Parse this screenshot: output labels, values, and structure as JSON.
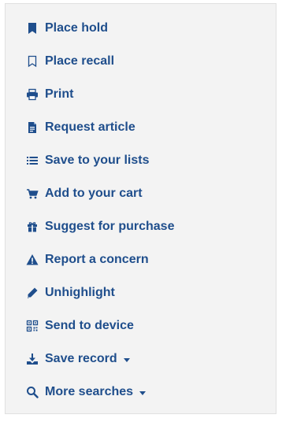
{
  "actions": [
    {
      "label": "Place hold",
      "icon": "bookmark-filled-icon"
    },
    {
      "label": "Place recall",
      "icon": "bookmark-outline-icon"
    },
    {
      "label": "Print",
      "icon": "printer-icon"
    },
    {
      "label": "Request article",
      "icon": "document-icon"
    },
    {
      "label": "Save to your lists",
      "icon": "list-icon"
    },
    {
      "label": "Add to your cart",
      "icon": "cart-icon"
    },
    {
      "label": "Suggest for purchase",
      "icon": "gift-icon"
    },
    {
      "label": "Report a concern",
      "icon": "warning-icon"
    },
    {
      "label": "Unhighlight",
      "icon": "pencil-icon"
    },
    {
      "label": "Send to device",
      "icon": "qr-code-icon"
    },
    {
      "label": "Save record",
      "icon": "download-icon",
      "has_dropdown": true
    },
    {
      "label": "More searches",
      "icon": "search-icon",
      "has_dropdown": true
    }
  ],
  "colors": {
    "link": "#1f4e8c",
    "panel_bg": "#f3f3f3",
    "panel_border": "#e0e0e0"
  }
}
